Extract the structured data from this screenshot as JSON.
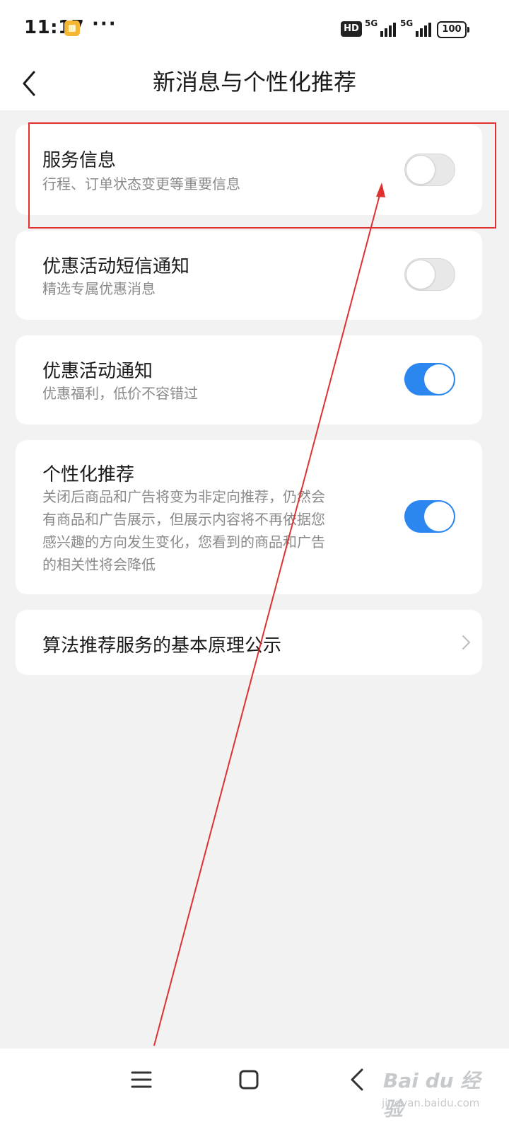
{
  "status_bar": {
    "time": "11:17",
    "more": "···",
    "hd": "HD",
    "network_1": "5G",
    "network_2": "5G",
    "battery": "100"
  },
  "header": {
    "title": "新消息与个性化推荐"
  },
  "settings": [
    {
      "title": "服务信息",
      "desc": "行程、订单状态变更等重要信息",
      "enabled": false
    },
    {
      "title": "优惠活动短信通知",
      "desc": "精选专属优惠消息",
      "enabled": false
    },
    {
      "title": "优惠活动通知",
      "desc": "优惠福利，低价不容错过",
      "enabled": true
    },
    {
      "title": "个性化推荐",
      "desc_lines": [
        "关闭后商品和广告将变为非定向推荐，仍然会",
        "有商品和广告展示，但展示内容将不再依据您",
        "感兴趣的方向发生变化，您看到的商品和广告",
        "的相关性将会降低"
      ],
      "enabled": true
    }
  ],
  "link_row": {
    "title": "算法推荐服务的基本原理公示"
  },
  "colors": {
    "toggle_on": "#2b86f0",
    "toggle_off": "#e8e8e8",
    "annotation": "#e03131"
  },
  "icons": {
    "back": "chevron-left-icon",
    "link": "chevron-right-icon",
    "nav_menu": "menu-icon",
    "nav_home": "square-icon",
    "nav_back": "back-triangle-icon"
  },
  "watermark": {
    "brand": "Bai du 经验",
    "url": "jingyan.baidu.com"
  }
}
